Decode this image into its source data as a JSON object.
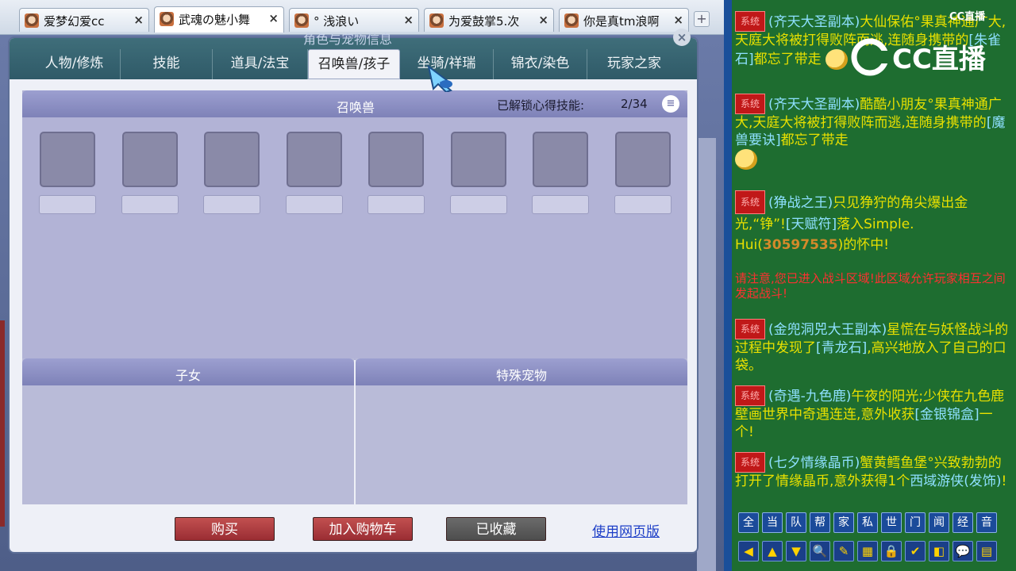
{
  "browser": {
    "tabs": [
      {
        "title": "爱梦幻爱cc",
        "close": "×"
      },
      {
        "title": "武魂の魅小舞",
        "close": "×"
      },
      {
        "title": "° 浅浪い",
        "close": "×"
      },
      {
        "title": "为爱鼓掌5.次",
        "close": "×"
      },
      {
        "title": "你是真tm浪啊",
        "close": "×"
      }
    ],
    "active_tab": 1,
    "new_tab": "+"
  },
  "dialog": {
    "title": "角色与宠物信息",
    "close": "×",
    "tabs": [
      "人物/修炼",
      "技能",
      "道具/法宝",
      "召唤兽/孩子",
      "坐骑/祥瑞",
      "锦衣/染色",
      "玩家之家"
    ],
    "active_tab": 3,
    "summon": {
      "title": "召唤兽",
      "unlock_label": "已解锁心得技能:",
      "unlock_count": "2/34",
      "menu_icon": "≡"
    },
    "children_title": "子女",
    "special_pet_title": "特殊宠物",
    "buttons": {
      "buy": "购买",
      "add_cart": "加入购物车",
      "collected": "已收藏",
      "web_version": "使用网页版"
    }
  },
  "chat": {
    "logo": "CC直播",
    "messages": [
      {
        "badge": "系统",
        "source": "(齐天大圣副本)",
        "text_a": "大仙保佑°果真神通广大,天庭大将被打得败阵而逃,连随身携带的",
        "item": "[朱雀石]",
        "text_b": "都忘了带走"
      },
      {
        "badge": "系统",
        "source": "(齐天大圣副本)",
        "text_a": "酷酷小朋友°果真神通广大,天庭大将被打得败阵而逃,连随身携带的",
        "item": "[魔兽要诀]",
        "text_b": "都忘了带走"
      },
      {
        "badge": "系统",
        "source": "(狰战之王)",
        "text_a": "只见狰狞的角尖爆出金光,“铮”!",
        "item": "[天赋符]",
        "text_b": "落入Simple. Hui(",
        "numbers": "30597535",
        "text_c": ")的怀中!"
      },
      {
        "warning": "请注意,您已进入战斗区域!此区域允许玩家相互之间发起战斗!"
      },
      {
        "badge": "系统",
        "source": "(金兜洞兕大王副本)",
        "text_a": "星慌在与妖怪战斗的过程中发现了",
        "item": "[青龙石]",
        "text_b": ",高兴地放入了自己的口袋。"
      },
      {
        "badge": "系统",
        "source": "(奇遇-九色鹿)",
        "text_a": "午夜的阳光;少侠在九色鹿壁画世界中奇遇连连,意外收获",
        "item": "[金银锦盒]",
        "text_b": "一个!"
      },
      {
        "badge": "系统",
        "source": "(七夕情缘晶币)",
        "text_a": "蟹黄鳕鱼堡°兴致勃勃的打开了情缘晶币,意外获得1个",
        "item": "西域游侠(发饰)",
        "text_b": "!"
      }
    ],
    "channels": [
      "全",
      "当",
      "队",
      "帮",
      "家",
      "私",
      "世",
      "门",
      "闻",
      "经",
      "音"
    ],
    "tools": [
      "◀",
      "▲",
      "▼",
      "🔍",
      "✎",
      "▦",
      "🔒",
      "✔",
      "◧",
      "💬",
      "▤"
    ]
  }
}
